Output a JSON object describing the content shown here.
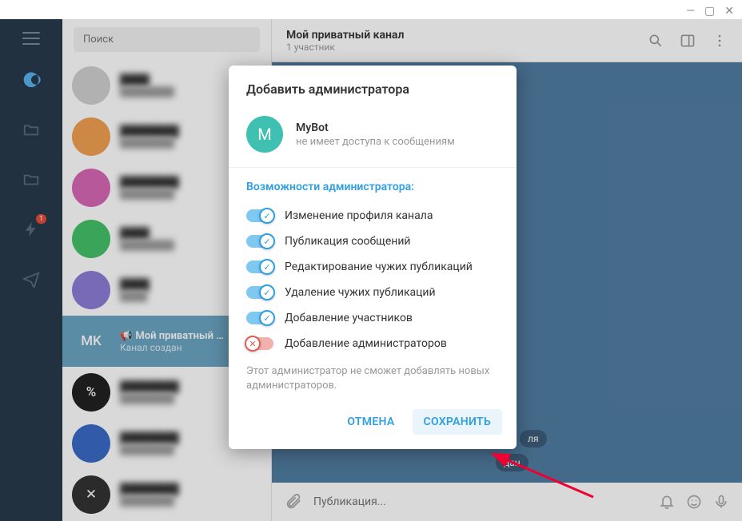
{
  "window_controls": {
    "min": "—",
    "max": "▢",
    "close": "✕"
  },
  "search": {
    "placeholder": "Поиск"
  },
  "nav_rail": [
    {
      "icon": "chats",
      "active": true,
      "badge": ""
    },
    {
      "icon": "folder",
      "active": false
    },
    {
      "icon": "folder2",
      "active": false
    },
    {
      "icon": "boost",
      "active": false,
      "badge": "1"
    },
    {
      "icon": "plane",
      "active": false
    }
  ],
  "chat_list": [
    {
      "avatar_bg": "#d0d0d0",
      "initials": "",
      "name": "████",
      "sub": "████████"
    },
    {
      "avatar_bg": "#f0a050",
      "initials": "",
      "name": "████████",
      "sub": "████████"
    },
    {
      "avatar_bg": "#d768b6",
      "initials": "",
      "name": "████████",
      "sub": "████████"
    },
    {
      "avatar_bg": "#45c169",
      "initials": "",
      "name": "████",
      "sub": "████████"
    },
    {
      "avatar_bg": "#8f7dd8",
      "initials": "",
      "name": "████",
      "sub": "████"
    },
    {
      "avatar_bg": "#6ca5c2",
      "initials": "MK",
      "name": "📢 Мой приватный …",
      "sub": "Канал создан",
      "selected": true
    },
    {
      "avatar_bg": "#222",
      "initials": "%",
      "name": "████████",
      "sub": "████████"
    },
    {
      "avatar_bg": "#3a6cc7",
      "initials": "",
      "name": "████████",
      "sub": "████████"
    },
    {
      "avatar_bg": "#333",
      "initials": "✕",
      "name": "████████",
      "sub": "████████"
    }
  ],
  "chat_header": {
    "title": "Мой приватный канал",
    "members": "1 участник"
  },
  "chat_body": {
    "chip_date": "ля",
    "chip_created": "дан"
  },
  "compose": {
    "placeholder": "Публикация..."
  },
  "dialog": {
    "title": "Добавить администратора",
    "bot_initial": "M",
    "bot_name": "MyBot",
    "bot_sub": "не имеет доступа к сообщениям",
    "perms_title": "Возможности администратора:",
    "permissions": [
      {
        "label": "Изменение профиля канала",
        "on": true
      },
      {
        "label": "Публикация сообщений",
        "on": true
      },
      {
        "label": "Редактирование чужих публикаций",
        "on": true
      },
      {
        "label": "Удаление чужих публикаций",
        "on": true
      },
      {
        "label": "Добавление участников",
        "on": true
      },
      {
        "label": "Добавление администраторов",
        "on": false
      }
    ],
    "note": "Этот администратор не сможет добавлять новых администраторов.",
    "cancel": "ОТМЕНА",
    "save": "СОХРАНИТЬ"
  }
}
